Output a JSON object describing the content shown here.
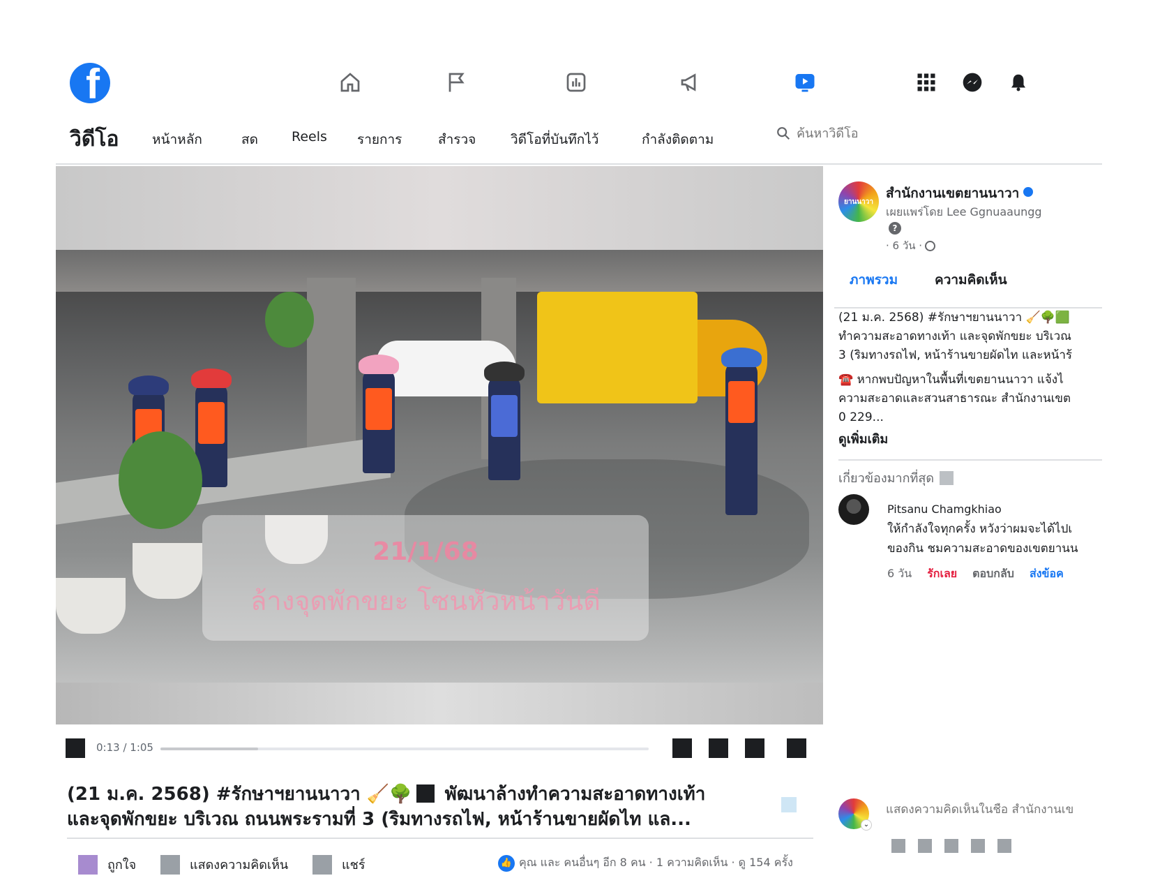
{
  "topbar": {
    "logo": "f",
    "nav_icons": [
      "home-icon",
      "flag-icon",
      "chart-icon",
      "megaphone-icon",
      "video-icon"
    ],
    "active_nav": "video-icon",
    "right_icons": [
      "grid-menu-icon",
      "messenger-icon",
      "bell-icon"
    ]
  },
  "subnav": {
    "title": "วิดีโอ",
    "items": [
      "หน้าหลัก",
      "สด",
      "Reels",
      "รายการ",
      "สำรวจ",
      "วิดีโอที่บันทึกไว้",
      "กำลังติดตาม"
    ],
    "search_placeholder": "ค้นหาวิดีโอ"
  },
  "video": {
    "overlay_date": "21/1/68",
    "overlay_text": "ล้างจุดพักขยะ โซนหัวหน้าวันดี",
    "time_current": "0:13",
    "time_total": "1:05",
    "progress": 0.2,
    "caption_line1_a": "(21 ม.ค. 2568) #รักษาฯยานนาวา",
    "caption_line1_b": "พัฒนาล้างทำความสะอาดทางเท้า",
    "caption_line2": "และจุดพักขยะ บริเวณ ถนนพระรามที่ 3 (ริมทางรถไฟ, หน้าร้านขายผัดไท แล..."
  },
  "actions": {
    "like": "ถูกใจ",
    "comment": "แสดงความคิดเห็น",
    "share": "แชร์",
    "like_color": "#a78bcf",
    "box_color": "#9aa0a6"
  },
  "stats": {
    "text": "คุณ และ คนอื่นๆ อีก 8 คน · 1 ความคิดเห็น · ดู 154 ครั้ง"
  },
  "page": {
    "name": "สำนักงานเขตยานนาวา",
    "avatar_text": "ยานนาวา",
    "shared_by": "เผยแพร่โดย Lee Ggnuaaungg",
    "time": "· 6 วัน ·"
  },
  "tabs": {
    "overview": "ภาพรวม",
    "comments": "ความคิดเห็น"
  },
  "post": {
    "line1": "(21 ม.ค. 2568) #รักษาฯยานนาวา 🧹🌳🟩",
    "line2": "ทำความสะอาดทางเท้า และจุดพักขยะ บริเวณ",
    "line3": "3 (ริมทางรถไฟ, หน้าร้านขายผัดไท และหน้าร้",
    "line4": "☎️ หากพบปัญหาในพื้นที่เขตยานนาวา แจ้งไ",
    "line5": "ความสะอาดและสวนสาธารณะ สำนักงานเขต",
    "line6": "0 229...",
    "see_more": "ดูเพิ่มเติม"
  },
  "comments": {
    "sort_label": "เกี่ยวข้องมากที่สุด",
    "items": [
      {
        "name": "Pitsanu Chamgkhiao",
        "line1": "ให้กำลังใจทุกครั้ง หวังว่าผมจะได้ไปเ",
        "line2": "ของกิน ชมความสะอาดของเขตยานน",
        "time": "6 วัน",
        "love": "รักเลย",
        "reply": "ตอบกลับ",
        "send": "ส่งข้อค"
      }
    ],
    "input_placeholder": "แสดงความคิดเห็นในชื่อ สำนักงานเข"
  }
}
